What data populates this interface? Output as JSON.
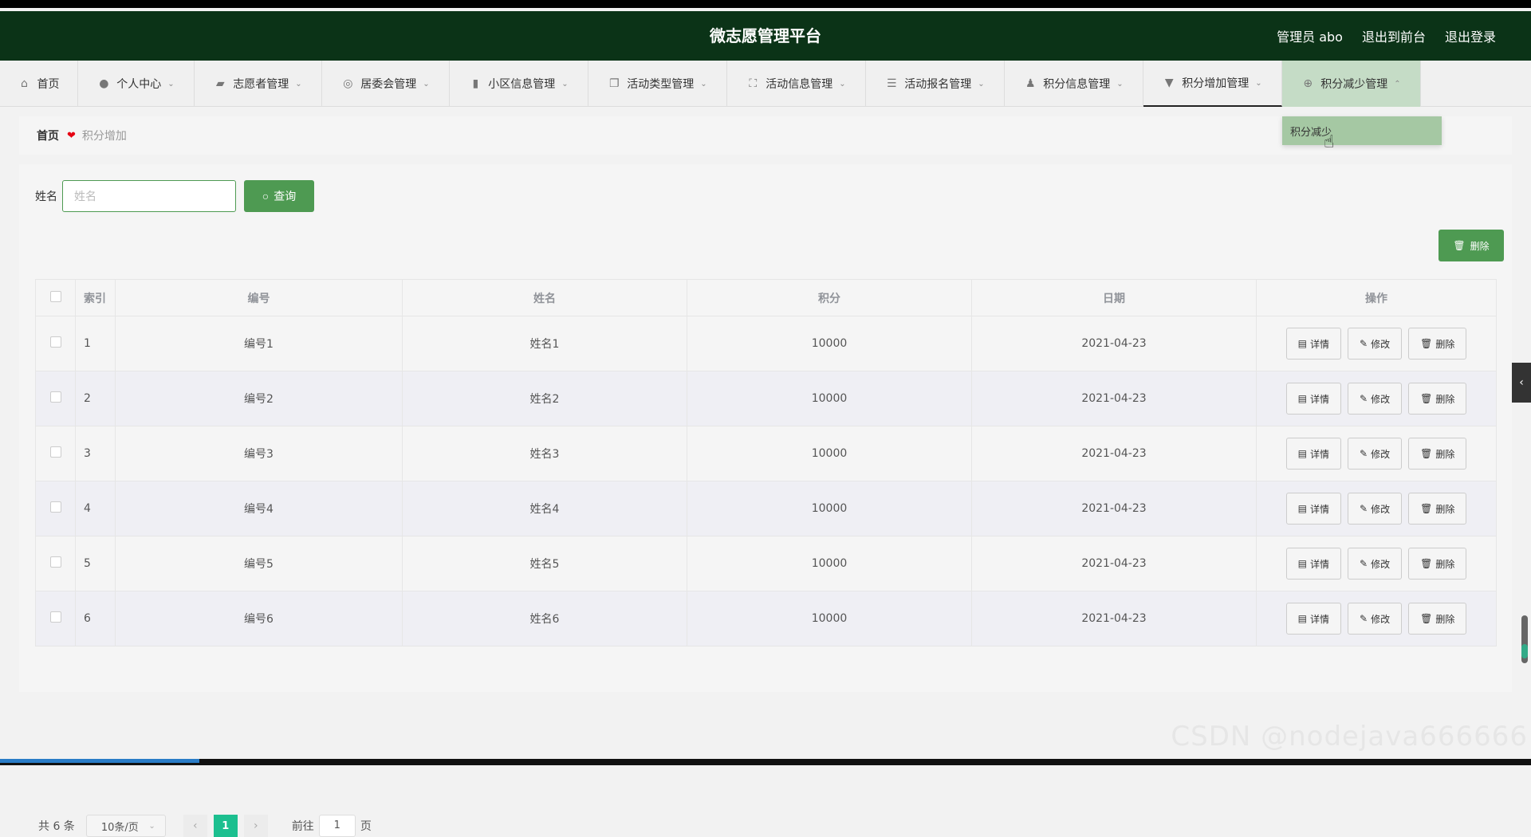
{
  "app": {
    "title": "微志愿管理平台"
  },
  "header": {
    "user": "管理员 abo",
    "to_front": "退出到前台",
    "logout": "退出登录"
  },
  "nav": [
    {
      "label": "首页",
      "icon": "home-icon"
    },
    {
      "label": "个人中心",
      "icon": "user-icon"
    },
    {
      "label": "志愿者管理",
      "icon": "briefcase-icon"
    },
    {
      "label": "居委会管理",
      "icon": "circle-target-icon"
    },
    {
      "label": "小区信息管理",
      "icon": "bar-chart-icon"
    },
    {
      "label": "活动类型管理",
      "icon": "copy-icon"
    },
    {
      "label": "活动信息管理",
      "icon": "fullscreen-icon"
    },
    {
      "label": "活动报名管理",
      "icon": "list-icon"
    },
    {
      "label": "积分信息管理",
      "icon": "person-icon"
    },
    {
      "label": "积分增加管理",
      "icon": "brush-icon"
    },
    {
      "label": "积分减少管理",
      "icon": "crosshair-icon"
    }
  ],
  "dropdown": {
    "item": "积分减少"
  },
  "breadcrumb": {
    "home": "首页",
    "current": "积分增加"
  },
  "search": {
    "label": "姓名",
    "placeholder": "姓名",
    "button": "查询"
  },
  "toolbar": {
    "delete": "删除"
  },
  "table": {
    "headers": [
      "索引",
      "编号",
      "姓名",
      "积分",
      "日期",
      "操作"
    ],
    "rows": [
      {
        "idx": "1",
        "code": "编号1",
        "name": "姓名1",
        "points": "10000",
        "date": "2021-04-23"
      },
      {
        "idx": "2",
        "code": "编号2",
        "name": "姓名2",
        "points": "10000",
        "date": "2021-04-23"
      },
      {
        "idx": "3",
        "code": "编号3",
        "name": "姓名3",
        "points": "10000",
        "date": "2021-04-23"
      },
      {
        "idx": "4",
        "code": "编号4",
        "name": "姓名4",
        "points": "10000",
        "date": "2021-04-23"
      },
      {
        "idx": "5",
        "code": "编号5",
        "name": "姓名5",
        "points": "10000",
        "date": "2021-04-23"
      },
      {
        "idx": "6",
        "code": "编号6",
        "name": "姓名6",
        "points": "10000",
        "date": "2021-04-23"
      }
    ],
    "ops": {
      "detail": "详情",
      "edit": "修改",
      "delete": "删除"
    }
  },
  "pager": {
    "total": "共 6 条",
    "size": "10条/页",
    "current": "1",
    "goto_prefix": "前往",
    "goto_value": "1",
    "goto_suffix": "页"
  },
  "watermark": "CSDN @nodejava666666",
  "colors": {
    "header_bg": "#0b3317",
    "accent": "#4e9a52",
    "pager_active": "#1cbf8f"
  }
}
